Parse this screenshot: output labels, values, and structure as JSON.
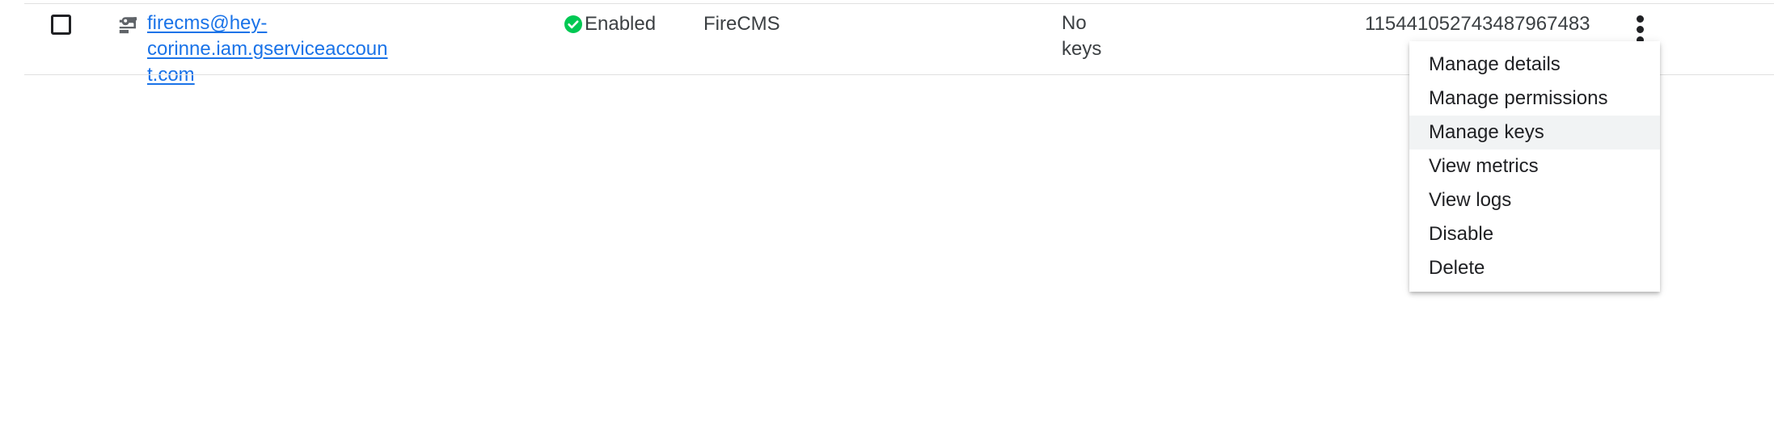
{
  "colors": {
    "link": "#1a73e8",
    "status_ok": "#00c853",
    "text_primary": "#202124",
    "text_secondary": "#3c4043",
    "divider": "#e0e0e0",
    "menu_highlight": "#f1f3f4"
  },
  "row": {
    "checkbox": {
      "name": "select-row-checkbox",
      "checked": false
    },
    "account_icon": "service-account-key-icon",
    "email": "firecms@hey-corinne.iam.gserviceaccount.com",
    "status": {
      "icon": "check-circle-icon",
      "label": "Enabled"
    },
    "name": "FireCMS",
    "keys": "No keys",
    "unique_id": "115441052743487967483",
    "overflow_icon": "more-vert-icon"
  },
  "menu": {
    "items": [
      {
        "label": "Manage details",
        "highlighted": false
      },
      {
        "label": "Manage permissions",
        "highlighted": false
      },
      {
        "label": "Manage keys",
        "highlighted": true
      },
      {
        "label": "View metrics",
        "highlighted": false
      },
      {
        "label": "View logs",
        "highlighted": false
      },
      {
        "label": "Disable",
        "highlighted": false
      },
      {
        "label": "Delete",
        "highlighted": false
      }
    ]
  }
}
